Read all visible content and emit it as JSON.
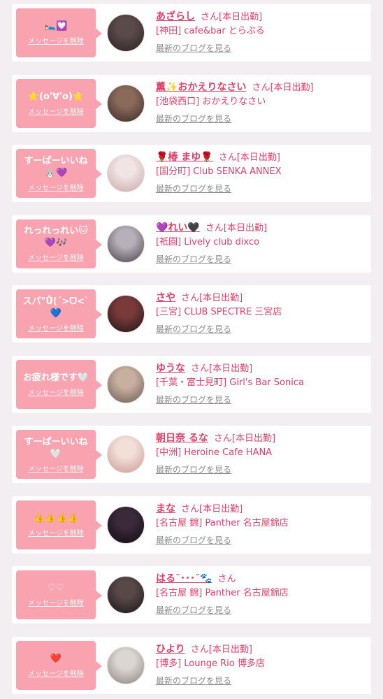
{
  "delete_label": "メッセージを削除",
  "san_label": "さん",
  "blog_label": "最新のブログを見る",
  "colors": {
    "accent": "#e0406a",
    "bubble": "#f9a3b0",
    "background": "#f2eef2",
    "card": "#ffffff"
  },
  "items": [
    {
      "message": "🛌💟",
      "name": "あざらし",
      "status": "[本日出勤]",
      "shop": "[神田] cafe&bar とらぶる",
      "avatar_colors": [
        "#5a4a4a",
        "#2b2222"
      ]
    },
    {
      "message": "⭐(o'∀'o)⭐",
      "name": "薫✨おかえりなさい",
      "status": "[本日出勤]",
      "shop": "[池袋西口] おかえりなさい",
      "avatar_colors": [
        "#8a6a5a",
        "#3a2a28"
      ]
    },
    {
      "message": "すーぱーいいね🐰💜",
      "name": "🌹椿 まゆ🌹",
      "status": "[本日出勤]",
      "shop": "[国分町] Club SENKA ANNEX",
      "avatar_colors": [
        "#f0e4e4",
        "#c8a8a8"
      ]
    },
    {
      "message": "れっれっれい🐱💜🎶",
      "name": "💜れい🖤",
      "status": "[本日出勤]",
      "shop": "[祇園] Lively club dixco",
      "avatar_colors": [
        "#b8b0b8",
        "#4a424a"
      ]
    },
    {
      "message": "スパ\"Ů(ˊ>ᗜ<ˋ💙",
      "name": "さや",
      "status": "[本日出勤]",
      "shop": "[三宮] CLUB SPECTRE 三宮店",
      "avatar_colors": [
        "#7a3a3a",
        "#1e1414"
      ]
    },
    {
      "message": "お疲れ様です🤍",
      "name": "ゆうな",
      "status": "[本日出勤]",
      "shop": "[千葉・富士見町] Girl's Bar Sonica",
      "avatar_colors": [
        "#c8b0a0",
        "#6a5a50"
      ]
    },
    {
      "message": "すーぱーいいね🤍",
      "name": "朝日奈 るな",
      "status": "[本日出勤]",
      "shop": "[中洲] Heroine Cafe HANA",
      "avatar_colors": [
        "#f2e0d8",
        "#c89890"
      ]
    },
    {
      "message": "👍👍👍👍",
      "name": "まな",
      "status": "[本日出勤]",
      "shop": "[名古屋 錦] Panther 名古屋錦店",
      "avatar_colors": [
        "#3a2a3a",
        "#120a12"
      ]
    },
    {
      "message": "♡♡",
      "name": "はる˘･･･˘🐾",
      "status": "",
      "shop": "[名古屋 錦] Panther 名古屋錦店",
      "avatar_colors": [
        "#584848",
        "#1a1414"
      ]
    },
    {
      "message": "❤️",
      "name": "ひより",
      "status": "[本日出勤]",
      "shop": "[博多] Lounge Rio 博多店",
      "avatar_colors": [
        "#dcd6d2",
        "#8a8480"
      ]
    }
  ]
}
